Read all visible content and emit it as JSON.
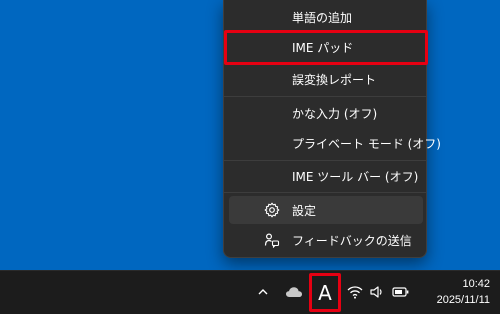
{
  "ime_menu": {
    "items": [
      {
        "label": "単語の追加"
      },
      {
        "label": "IME パッド"
      },
      {
        "label": "誤変換レポート"
      },
      {
        "label": "かな入力 (オフ)"
      },
      {
        "label": "プライベート モード (オフ)"
      },
      {
        "label": "IME ツール バー (オフ)"
      },
      {
        "label": "設定",
        "icon": "gear-icon"
      },
      {
        "label": "フィードバックの送信",
        "icon": "feedback-icon"
      }
    ]
  },
  "taskbar": {
    "ime_indicator": "A",
    "clock": {
      "time": "10:42",
      "date": "2025/11/11"
    },
    "tray_icons": [
      "chevron-up-icon",
      "cloud-icon",
      "wifi-icon",
      "speaker-icon",
      "battery-icon"
    ]
  },
  "colors": {
    "desktop": "#0067c0",
    "menu_bg": "#2c2c2c",
    "taskbar_bg": "#1c1c1c",
    "highlight": "#e60012"
  }
}
